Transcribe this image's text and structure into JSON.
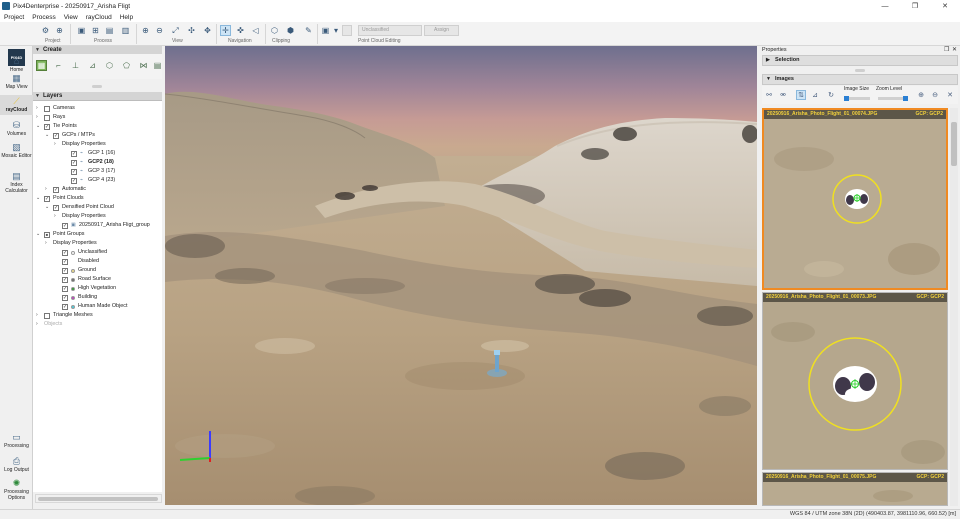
{
  "window": {
    "title": "Pix4Denterprise - 20250917_Arisha Fligt",
    "controls": [
      "—",
      "❐",
      "✕"
    ]
  },
  "menu": [
    "Project",
    "Process",
    "View",
    "rayCloud",
    "Help"
  ],
  "toolbar": {
    "groups": [
      "Project",
      "Process",
      "View",
      "Navigation",
      "Clipping",
      "Point Cloud Editing"
    ],
    "field_unclassified": "Unclassified",
    "field_assign": "Assign"
  },
  "nav": {
    "logo": "PIX4D",
    "items": [
      {
        "label": "Home",
        "icon": "home-icon"
      },
      {
        "label": "Map View",
        "icon": "map-icon"
      },
      {
        "label": "rayCloud",
        "icon": "raycloud-icon"
      },
      {
        "label": "Volumes",
        "icon": "volume-icon"
      },
      {
        "label": "Mosaic Editor",
        "icon": "mosaic-icon"
      },
      {
        "label": "Index Calculator",
        "icon": "index-icon"
      }
    ],
    "bottom": [
      {
        "label": "Processing",
        "icon": "processing-icon"
      },
      {
        "label": "Log Output",
        "icon": "log-icon"
      },
      {
        "label": "Processing Options",
        "icon": "processing-options-icon"
      }
    ]
  },
  "create_panel": {
    "title": "Create"
  },
  "layers_panel": {
    "title": "Layers",
    "rows": [
      {
        "label": "Cameras",
        "level": 0,
        "arrow": "›",
        "check": false
      },
      {
        "label": "Rays",
        "level": 0,
        "arrow": "›",
        "check": false
      },
      {
        "label": "Tie Points",
        "level": 0,
        "arrow": "⌄",
        "check": true
      },
      {
        "label": "GCPs / MTPs",
        "level": 1,
        "arrow": "⌄",
        "check": true
      },
      {
        "label": "Display Properties",
        "level": 2,
        "arrow": "›",
        "check": null
      },
      {
        "label": "GCP 1 (16)",
        "level": 3,
        "arrow": "",
        "check": true
      },
      {
        "label": "GCP2 (18)",
        "level": 3,
        "arrow": "",
        "check": true,
        "bold": true
      },
      {
        "label": "GCP 3 (17)",
        "level": 3,
        "arrow": "",
        "check": true
      },
      {
        "label": "GCP 4 (23)",
        "level": 3,
        "arrow": "",
        "check": true
      },
      {
        "label": "Automatic",
        "level": 1,
        "arrow": "›",
        "check": true
      },
      {
        "label": "Point Clouds",
        "level": 0,
        "arrow": "⌄",
        "check": true
      },
      {
        "label": "Densified Point Cloud",
        "level": 1,
        "arrow": "⌄",
        "check": true
      },
      {
        "label": "Display Properties",
        "level": 2,
        "arrow": "›",
        "check": null
      },
      {
        "label": "20250917_Arisha Fligt_group",
        "level": 2,
        "arrow": "",
        "check": true
      },
      {
        "label": "Point Groups",
        "level": 0,
        "arrow": "⌄",
        "check": "partial"
      },
      {
        "label": "Display Properties",
        "level": 1,
        "arrow": "›",
        "check": null
      },
      {
        "label": "Unclassified",
        "level": 2,
        "arrow": "",
        "check": true,
        "dot": "#ffffff"
      },
      {
        "label": "Disabled",
        "level": 2,
        "arrow": "",
        "check": true,
        "dot": null
      },
      {
        "label": "Ground",
        "level": 2,
        "arrow": "",
        "check": true,
        "dot": "#f2e08a"
      },
      {
        "label": "Road Surface",
        "level": 2,
        "arrow": "",
        "check": true,
        "dot": "#6a6a6a"
      },
      {
        "label": "High Vegetation",
        "level": 2,
        "arrow": "",
        "check": true,
        "dot": "#2e9a2e"
      },
      {
        "label": "Building",
        "level": 2,
        "arrow": "",
        "check": true,
        "dot": "#c23ac2"
      },
      {
        "label": "Human Made Object",
        "level": 2,
        "arrow": "",
        "check": true,
        "dot": "#4ad0e0"
      },
      {
        "label": "Triangle Meshes",
        "level": 0,
        "arrow": "›",
        "check": false
      },
      {
        "label": "Objects",
        "level": 0,
        "arrow": "›",
        "check": null,
        "greyed": true
      }
    ]
  },
  "properties": {
    "title": "Properties",
    "selection_label": "Selection",
    "images_label": "Images",
    "image_size_label": "Image Size",
    "zoom_level_label": "Zoom Level",
    "image_size_value": 0.0,
    "zoom_level_value": 1.0,
    "images": [
      {
        "name": "20250916_Arisha_Photo_Flight_01_00074.JPG",
        "gcp": "GCP: GCP2",
        "selected": true
      },
      {
        "name": "20250916_Arisha_Photo_Flight_01_00073.JPG",
        "gcp": "GCP: GCP2",
        "selected": false
      },
      {
        "name": "20250916_Arisha_Photo_Flight_01_00075.JPG",
        "gcp": "GCP: GCP2",
        "selected": false
      }
    ]
  },
  "status": {
    "coords": "WGS 84 / UTM zone 38N (2D)    (490403.87, 3981110.96, 660.52) [m]"
  },
  "colors": {
    "accent": "#f08a22",
    "gcp_circle": "#f0e020",
    "nav_active_icon": "#e8c23a"
  }
}
